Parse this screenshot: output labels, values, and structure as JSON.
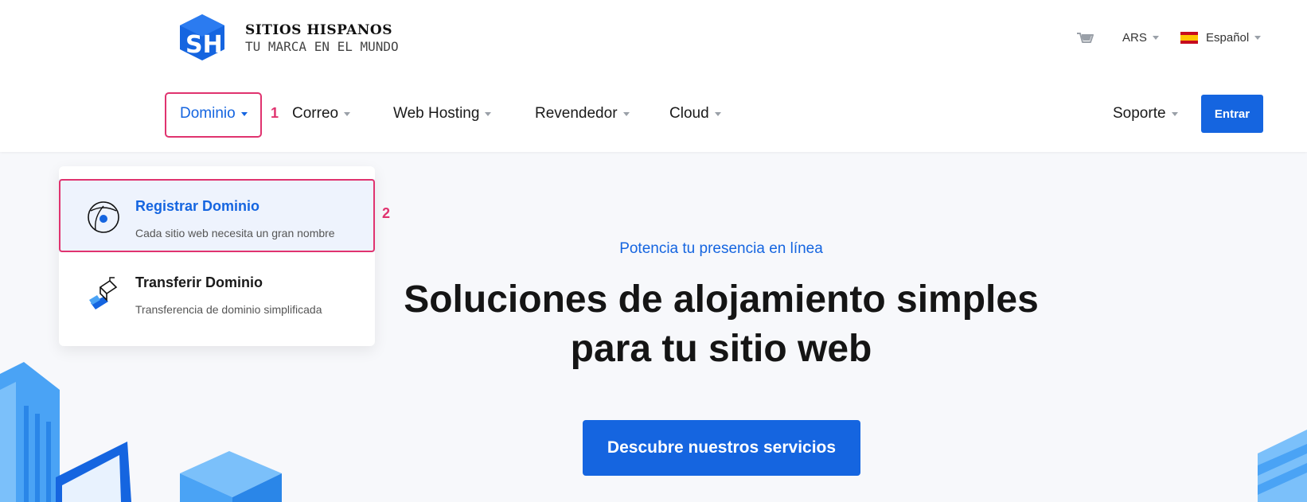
{
  "brand": {
    "title": "SITIOS HISPANOS",
    "subtitle": "TU MARCA EN EL MUNDO",
    "logo_letters": "SH"
  },
  "top_bar": {
    "currency": "ARS",
    "language": "Español"
  },
  "nav": {
    "items": [
      {
        "label": "Dominio"
      },
      {
        "label": "Correo"
      },
      {
        "label": "Web Hosting"
      },
      {
        "label": "Revendedor"
      },
      {
        "label": "Cloud"
      }
    ],
    "support_label": "Soporte",
    "login_label": "Entrar"
  },
  "annotations": {
    "step1": "1",
    "step2": "2"
  },
  "dropdown": {
    "items": [
      {
        "title": "Registrar Dominio",
        "description": "Cada sitio web necesita un gran nombre"
      },
      {
        "title": "Transferir Dominio",
        "description": "Transferencia de dominio simplificada"
      }
    ]
  },
  "hero": {
    "eyebrow": "Potencia tu presencia en línea",
    "title_line1": "Soluciones de alojamiento simples",
    "title_line2": "para tu sitio web",
    "cta": "Descubre nuestros servicios"
  },
  "colors": {
    "accent": "#1565e0",
    "highlight": "#e0336f"
  }
}
